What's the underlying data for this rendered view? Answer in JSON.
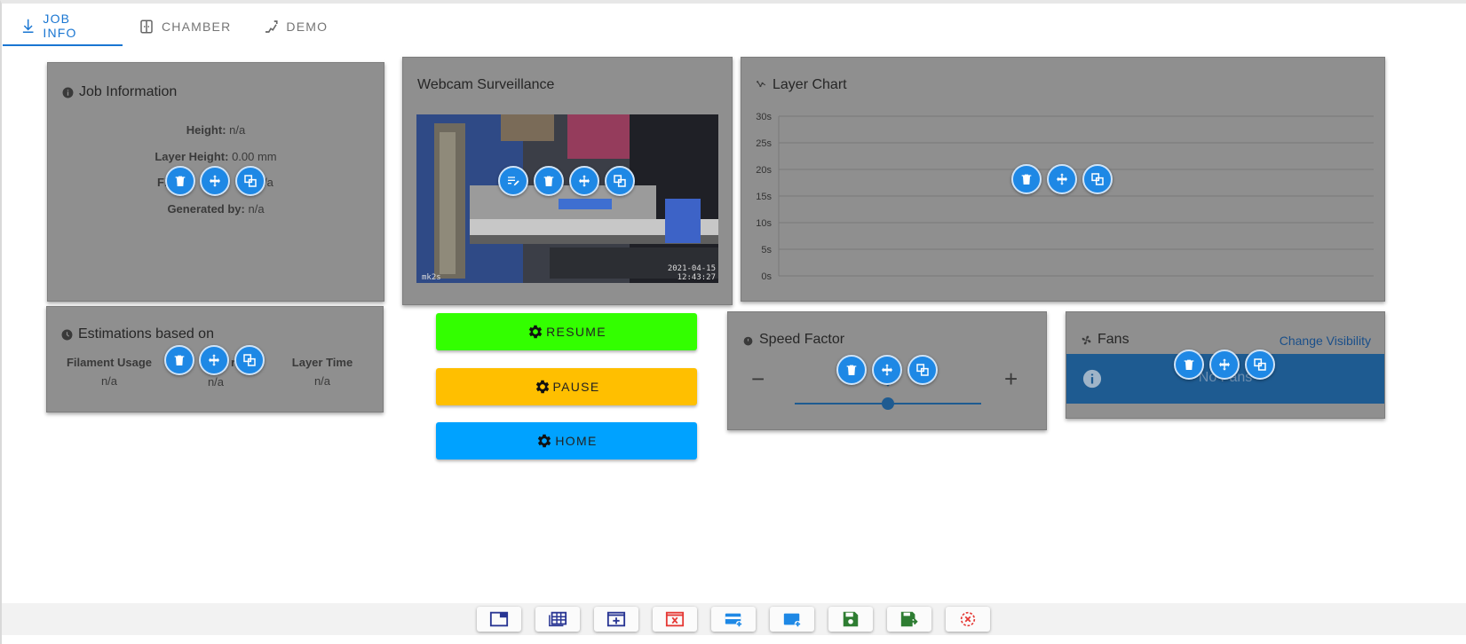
{
  "tabs": [
    {
      "label": "JOB INFO",
      "icon": "download-arrow-icon",
      "active": true
    },
    {
      "label": "CHAMBER",
      "icon": "chamber-icon",
      "active": false
    },
    {
      "label": "DEMO",
      "icon": "demo-icon",
      "active": false
    }
  ],
  "job_info": {
    "title": "Job Information",
    "height_label": "Height:",
    "height_value": "n/a",
    "layer_height_label": "Layer Height:",
    "layer_height_value": "0.00 mm",
    "filament_usage_label_visible": "Fi",
    "filament_usage_label_visible_2": "n",
    "filament_usage_label_visible_3": "ag",
    "filament_usage_value_visible": "/a",
    "generated_by_label": "Generated by:",
    "generated_by_value": "n/a"
  },
  "estimations": {
    "title": "Estimations based on",
    "col1_label": "Filament Usage",
    "col1_value": "n/a",
    "col2_label_visible": "e",
    "col2_label_visible_2": "r",
    "col2_value": "n/a",
    "col3_label": "Layer Time",
    "col3_value": "n/a"
  },
  "webcam": {
    "title": "Webcam Surveillance",
    "overlay_left": "mk2s",
    "overlay_date": "2021-04-15",
    "overlay_time": "12:43:27"
  },
  "layer_chart": {
    "title": "Layer Chart"
  },
  "chart_data": {
    "type": "line",
    "title": "Layer Chart",
    "y_ticks": [
      "0s",
      "5s",
      "10s",
      "15s",
      "20s",
      "25s",
      "30s"
    ],
    "ylim": [
      0,
      30
    ],
    "series": [],
    "grid": true
  },
  "buttons": {
    "resume": "RESUME",
    "pause": "PAUSE",
    "home": "HOME"
  },
  "speed_factor": {
    "title": "Speed Factor",
    "minus": "−",
    "plus": "+",
    "slider_value": 0.5
  },
  "fans": {
    "title": "Fans",
    "change_visibility": "Change Visibility",
    "no_fans_visible": "No Fans"
  },
  "colors": {
    "card_bg": "#8f8f8f",
    "accent": "#1e88e5",
    "resume": "#33ff00",
    "pause": "#ffbf00",
    "home": "#00a2ff",
    "fans_banner": "#1e5b91"
  },
  "toolbar": [
    {
      "icon": "window-icon",
      "color": "#283593"
    },
    {
      "icon": "grid-layout-icon",
      "color": "#283593"
    },
    {
      "icon": "add-window-icon",
      "color": "#283593"
    },
    {
      "icon": "remove-window-icon",
      "color": "#e53935"
    },
    {
      "icon": "add-card-icon",
      "color": "#1e88e5"
    },
    {
      "icon": "add-panel-icon",
      "color": "#1e88e5"
    },
    {
      "icon": "save-icon",
      "color": "#2e7d32"
    },
    {
      "icon": "save-export-icon",
      "color": "#2e7d32"
    },
    {
      "icon": "cancel-icon",
      "color": "#e53935"
    }
  ]
}
